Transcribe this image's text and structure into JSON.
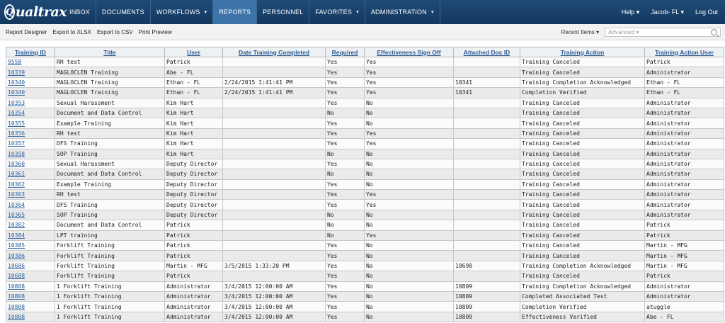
{
  "app": {
    "logo": "Qualtrax",
    "logo_letter": "Q",
    "logo_rest": "ualtrax"
  },
  "nav": [
    {
      "label": "INBOX",
      "caret": false,
      "active": false
    },
    {
      "label": "DOCUMENTS",
      "caret": false,
      "active": false
    },
    {
      "label": "WORKFLOWS",
      "caret": true,
      "active": false
    },
    {
      "label": "REPORTS",
      "caret": false,
      "active": true
    },
    {
      "label": "PERSONNEL",
      "caret": false,
      "active": false
    },
    {
      "label": "FAVORITES",
      "caret": true,
      "active": false
    },
    {
      "label": "ADMINISTRATION",
      "caret": true,
      "active": false
    }
  ],
  "right_nav": {
    "help": "Help ▾",
    "user": "Jacob- FL ▾",
    "logout": "Log Out"
  },
  "toolbar": {
    "report_designer": "Report Designer",
    "export_xlsx": "Export to XLSX",
    "export_csv": "Export to CSV",
    "print_preview": "Print Preview",
    "recent_items": "Recent Items ▾",
    "search_placeholder": "Advanced ▾"
  },
  "table": {
    "columns": [
      "Training ID",
      "Title",
      "User",
      "Date Training Completed",
      "Required",
      "Effectiveness Sign Off",
      "Attached Doc ID",
      "Training Action",
      "Training Action User"
    ],
    "rows": [
      [
        "9558",
        "RH test",
        "Patrick",
        "",
        "Yes",
        "Yes",
        "",
        "Training Canceled",
        "Patrick"
      ],
      [
        "10339",
        "MAGLOCLEN Training",
        "Abe - FL",
        "",
        "Yes",
        "Yes",
        "",
        "Training Canceled",
        "Administrator"
      ],
      [
        "10340",
        "MAGLOCLEN Training",
        "Ethan - FL",
        "2/24/2015 1:41:41 PM",
        "Yes",
        "Yes",
        "10341",
        "Training Completion Acknowledged",
        "Ethan - FL"
      ],
      [
        "10340",
        "MAGLOCLEN Training",
        "Ethan - FL",
        "2/24/2015 1:41:41 PM",
        "Yes",
        "Yes",
        "10341",
        "Completion Verified",
        "Ethan - FL"
      ],
      [
        "10353",
        "Sexual Harassment",
        "Kim Hart",
        "",
        "Yes",
        "No",
        "",
        "Training Canceled",
        "Administrator"
      ],
      [
        "10354",
        "Document and Data Control",
        "Kim Hart",
        "",
        "No",
        "No",
        "",
        "Training Canceled",
        "Administrator"
      ],
      [
        "10355",
        "Example Training",
        "Kim Hart",
        "",
        "Yes",
        "No",
        "",
        "Training Canceled",
        "Administrator"
      ],
      [
        "10356",
        "RH test",
        "Kim Hart",
        "",
        "Yes",
        "Yes",
        "",
        "Training Canceled",
        "Administrator"
      ],
      [
        "10357",
        "DFS Training",
        "Kim Hart",
        "",
        "Yes",
        "Yes",
        "",
        "Training Canceled",
        "Administrator"
      ],
      [
        "10358",
        "SOP Training",
        "Kim Hart",
        "",
        "No",
        "No",
        "",
        "Training Canceled",
        "Administrator"
      ],
      [
        "10360",
        "Sexual Harassment",
        "Deputy Director",
        "",
        "Yes",
        "No",
        "",
        "Training Canceled",
        "Administrator"
      ],
      [
        "10361",
        "Document and Data Control",
        "Deputy Director",
        "",
        "No",
        "No",
        "",
        "Training Canceled",
        "Administrator"
      ],
      [
        "10362",
        "Example Training",
        "Deputy Director",
        "",
        "Yes",
        "No",
        "",
        "Training Canceled",
        "Administrator"
      ],
      [
        "10363",
        "RH test",
        "Deputy Director",
        "",
        "Yes",
        "Yes",
        "",
        "Training Canceled",
        "Administrator"
      ],
      [
        "10364",
        "DFS Training",
        "Deputy Director",
        "",
        "Yes",
        "Yes",
        "",
        "Training Canceled",
        "Administrator"
      ],
      [
        "10365",
        "SOP Training",
        "Deputy Director",
        "",
        "No",
        "No",
        "",
        "Training Canceled",
        "Administrator"
      ],
      [
        "10382",
        "Document and Data Control",
        "Patrick",
        "",
        "No",
        "No",
        "",
        "Training Canceled",
        "Patrick"
      ],
      [
        "10384",
        "LPT training",
        "Patrick",
        "",
        "No",
        "Yes",
        "",
        "Training Canceled",
        "Patrick"
      ],
      [
        "10385",
        "Forklift Training",
        "Patrick",
        "",
        "Yes",
        "No",
        "",
        "Training Canceled",
        "Martin - MFG"
      ],
      [
        "10386",
        "Forklift Training",
        "Patrick",
        "",
        "Yes",
        "No",
        "",
        "Training Canceled",
        "Martin - MFG"
      ],
      [
        "10686",
        "Forklift Training",
        "Martin - MFG",
        "3/5/2015 1:33:20 PM",
        "Yes",
        "No",
        "10698",
        "Training Completion Acknowledged",
        "Martin - MFG"
      ],
      [
        "10688",
        "Forklift Training",
        "Patrick",
        "",
        "Yes",
        "No",
        "",
        "Training Canceled",
        "Patrick"
      ],
      [
        "10808",
        "1 Forklift Training",
        "Administrator",
        "3/4/2015 12:00:00 AM",
        "Yes",
        "No",
        "10809",
        "Training Completion Acknowledged",
        "Administrator"
      ],
      [
        "10808",
        "1 Forklift Training",
        "Administrator",
        "3/4/2015 12:00:00 AM",
        "Yes",
        "No",
        "10809",
        "Completed Associated Test",
        "Administrator"
      ],
      [
        "10808",
        "1 Forklift Training",
        "Administrator",
        "3/4/2015 12:00:00 AM",
        "Yes",
        "No",
        "10809",
        "Completion Verified",
        "atuggle"
      ],
      [
        "10808",
        "1 Forklift Training",
        "Administrator",
        "3/4/2015 12:00:00 AM",
        "Yes",
        "No",
        "10809",
        "Effectiveness Verified",
        "Abe - FL"
      ]
    ]
  }
}
